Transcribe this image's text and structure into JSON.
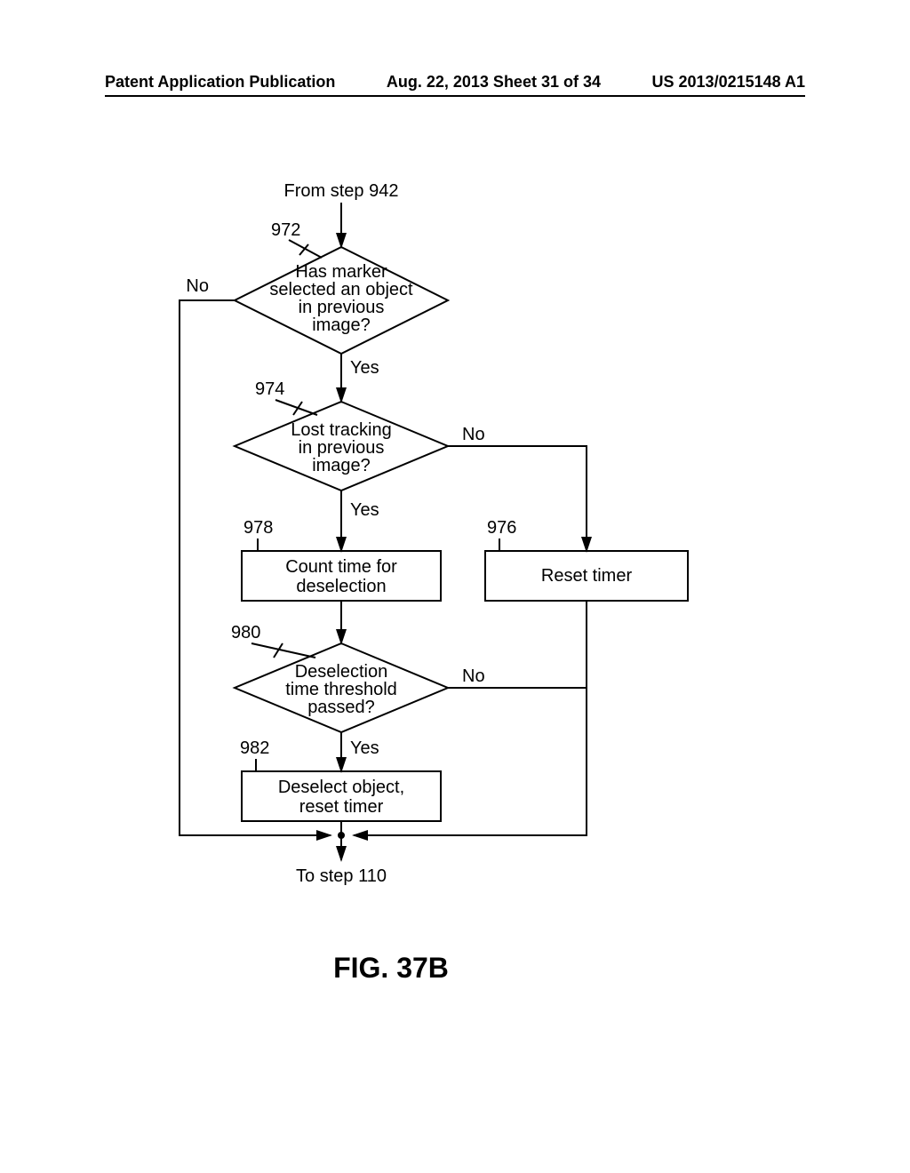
{
  "header": {
    "left": "Patent Application Publication",
    "center": "Aug. 22, 2013  Sheet 31 of 34",
    "right": "US 2013/0215148 A1"
  },
  "figure_label": "FIG. 37B",
  "entry": "From step 942",
  "exit": "To step 110",
  "refs": {
    "d972": "972",
    "d974": "974",
    "d976": "976",
    "d978": "978",
    "d980": "980",
    "d982": "982"
  },
  "decisions": {
    "d972": {
      "l1": "Has marker",
      "l2": "selected an object",
      "l3": "in previous",
      "l4": "image?"
    },
    "d974": {
      "l1": "Lost tracking",
      "l2": "in previous",
      "l3": "image?"
    },
    "d980": {
      "l1": "Deselection",
      "l2": "time threshold",
      "l3": "passed?"
    }
  },
  "boxes": {
    "b978": {
      "l1": "Count time for",
      "l2": "deselection"
    },
    "b976": "Reset timer",
    "b982": {
      "l1": "Deselect object,",
      "l2": "reset timer"
    }
  },
  "edges": {
    "yes": "Yes",
    "no": "No"
  },
  "chart_data": {
    "type": "flowchart",
    "nodes": [
      {
        "id": "entry",
        "type": "connector",
        "label": "From step 942"
      },
      {
        "id": "972",
        "type": "decision",
        "label": "Has marker selected an object in previous image?"
      },
      {
        "id": "974",
        "type": "decision",
        "label": "Lost tracking in previous image?"
      },
      {
        "id": "978",
        "type": "process",
        "label": "Count time for deselection"
      },
      {
        "id": "976",
        "type": "process",
        "label": "Reset timer"
      },
      {
        "id": "980",
        "type": "decision",
        "label": "Deselection time threshold passed?"
      },
      {
        "id": "982",
        "type": "process",
        "label": "Deselect object, reset timer"
      },
      {
        "id": "exit",
        "type": "connector",
        "label": "To step 110"
      }
    ],
    "edges": [
      {
        "from": "entry",
        "to": "972"
      },
      {
        "from": "972",
        "to": "974",
        "label": "Yes"
      },
      {
        "from": "972",
        "to": "exit",
        "label": "No"
      },
      {
        "from": "974",
        "to": "978",
        "label": "Yes"
      },
      {
        "from": "974",
        "to": "976",
        "label": "No"
      },
      {
        "from": "978",
        "to": "980"
      },
      {
        "from": "980",
        "to": "982",
        "label": "Yes"
      },
      {
        "from": "980",
        "to": "exit",
        "label": "No"
      },
      {
        "from": "976",
        "to": "exit"
      },
      {
        "from": "982",
        "to": "exit"
      }
    ]
  }
}
